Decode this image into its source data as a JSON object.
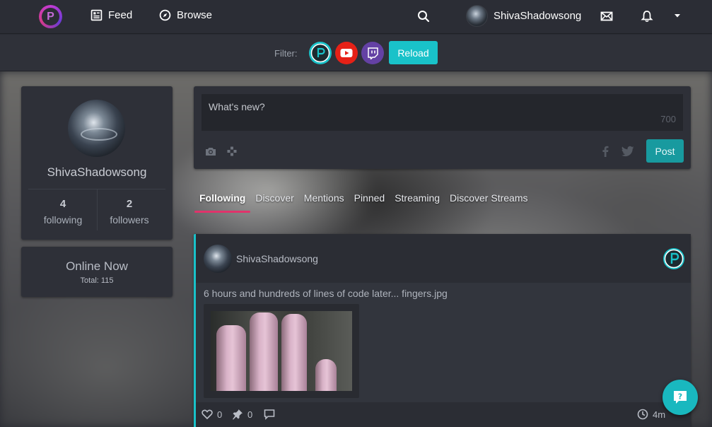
{
  "nav": {
    "logo_letter": "P",
    "feed_label": "Feed",
    "browse_label": "Browse",
    "username": "ShivaShadowsong"
  },
  "filter": {
    "label": "Filter:",
    "reload_label": "Reload",
    "platforms": [
      "picarto",
      "youtube",
      "twitch"
    ]
  },
  "profile": {
    "name": "ShivaShadowsong",
    "following_count": "4",
    "following_label": "following",
    "followers_count": "2",
    "followers_label": "followers"
  },
  "online": {
    "title": "Online Now",
    "total": "Total: 115"
  },
  "composer": {
    "placeholder": "What's new?",
    "char_limit": "700",
    "post_label": "Post"
  },
  "tabs": [
    {
      "label": "Following",
      "active": true
    },
    {
      "label": "Discover",
      "active": false
    },
    {
      "label": "Mentions",
      "active": false
    },
    {
      "label": "Pinned",
      "active": false
    },
    {
      "label": "Streaming",
      "active": false
    },
    {
      "label": "Discover Streams",
      "active": false
    }
  ],
  "post": {
    "author": "ShivaShadowsong",
    "text": "6 hours and hundreds of lines of code later... fingers.jpg",
    "likes": "0",
    "pins": "0",
    "time": "4m"
  },
  "colors": {
    "accent": "#19c2c9",
    "tab_underline": "#e0336b",
    "youtube": "#e62117",
    "twitch": "#6441a4"
  }
}
